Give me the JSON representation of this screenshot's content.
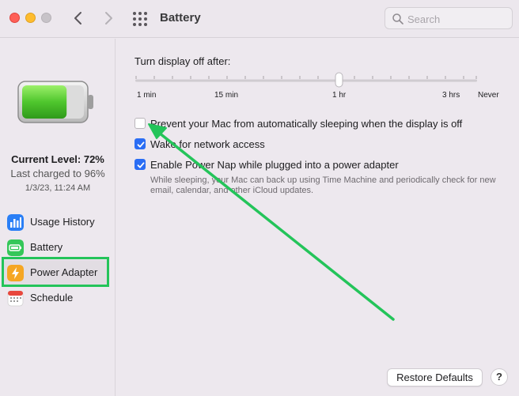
{
  "window": {
    "title": "Battery",
    "search_placeholder": "Search"
  },
  "sidebar": {
    "current_level": "Current Level: 72%",
    "last_charged": "Last charged to 96%",
    "charged_date": "1/3/23, 11:24 AM",
    "items": [
      {
        "label": "Usage History",
        "icon": "bar-chart-icon",
        "color": "#2a7ff6"
      },
      {
        "label": "Battery",
        "icon": "battery-icon",
        "color": "#34c759"
      },
      {
        "label": "Power Adapter",
        "icon": "lightning-icon",
        "color": "#f5a623",
        "selected": true
      },
      {
        "label": "Schedule",
        "icon": "calendar-icon",
        "color": "#e8473d"
      }
    ]
  },
  "main": {
    "slider_title": "Turn display off after:",
    "slider_ticks": [
      "1 min",
      "15 min",
      "1 hr",
      "3 hrs",
      "Never"
    ],
    "slider_value": "1 hr",
    "options": [
      {
        "label": "Prevent your Mac from automatically sleeping when the display is off",
        "checked": false
      },
      {
        "label": "Wake for network access",
        "checked": true
      },
      {
        "label": "Enable Power Nap while plugged into a power adapter",
        "checked": true
      }
    ],
    "power_nap_help": "While sleeping, your Mac can back up using Time Machine and periodically check for new email, calendar, and other iCloud updates.",
    "restore_defaults": "Restore Defaults",
    "help": "?"
  },
  "battery_level_fraction": 0.72,
  "colors": {
    "accent": "#2a6df4",
    "annotation": "#24c45a"
  }
}
